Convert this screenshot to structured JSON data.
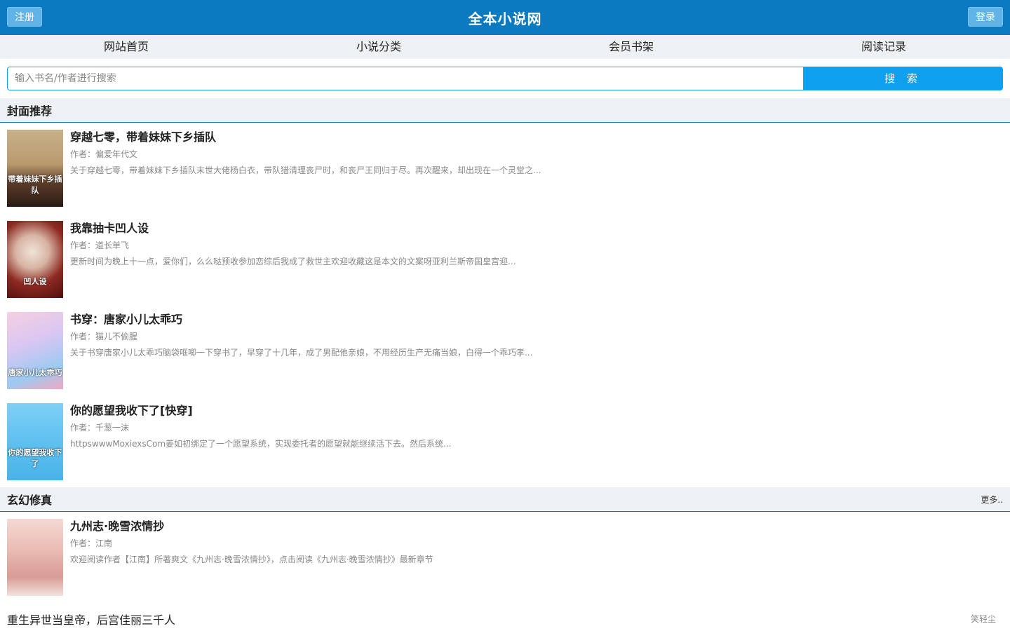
{
  "header": {
    "title": "全本小说网",
    "register_label": "注册",
    "login_label": "登录"
  },
  "nav": {
    "items": [
      "网站首页",
      "小说分类",
      "会员书架",
      "阅读记录"
    ]
  },
  "search": {
    "placeholder": "输入书名/作者进行搜索",
    "button_label": "搜 索"
  },
  "featured": {
    "title": "封面推荐",
    "books": [
      {
        "title": "穿越七零，带着妹妹下乡插队",
        "author": "作者：偏爱年代文",
        "desc": "关于穿越七零，带着妹妹下乡插队末世大佬杨白衣，带队猎清理丧尸时，和丧尸王同归于尽。再次醒来，却出现在一个灵堂之...",
        "cover_text": "带着妹妹下乡插队"
      },
      {
        "title": "我靠抽卡凹人设",
        "author": "作者：道长单飞",
        "desc": "更新时间为晚上十一点，爱你们，么么哒预收参加恋综后我成了救世主欢迎收藏这是本文的文案呀亚利兰斯帝国皇宫迎...",
        "cover_text": "凹人设"
      },
      {
        "title": "书穿：唐家小儿太乖巧",
        "author": "作者：猫儿不偷腥",
        "desc": "关于书穿唐家小儿太乖巧脑袋哐唧一下穿书了，早穿了十几年，成了男配他亲娘，不用经历生产无痛当娘，白得一个乖巧孝...",
        "cover_text": "唐家小儿太乖巧"
      },
      {
        "title": "你的愿望我收下了[快穿]",
        "author": "作者：千葱一沫",
        "desc": "httpswwwMoxiexsCom姜如初绑定了一个愿望系统，实现委托者的愿望就能继续活下去。然后系统...",
        "cover_text": "你的愿望我收下了"
      }
    ]
  },
  "xuanhuan": {
    "title": "玄幻修真",
    "more_label": "更多..",
    "top_book": {
      "title": "九州志·晚雪浓情抄",
      "author": "作者：江南",
      "desc": "欢迎阅读作者【江南】所著爽文《九州志·晚雪浓情抄》，点击阅读《九州志·晚雪浓情抄》最新章节"
    },
    "list": [
      {
        "title": "重生异世当皇帝，后宫佳丽三千人",
        "author": "笑轻尘"
      }
    ]
  }
}
